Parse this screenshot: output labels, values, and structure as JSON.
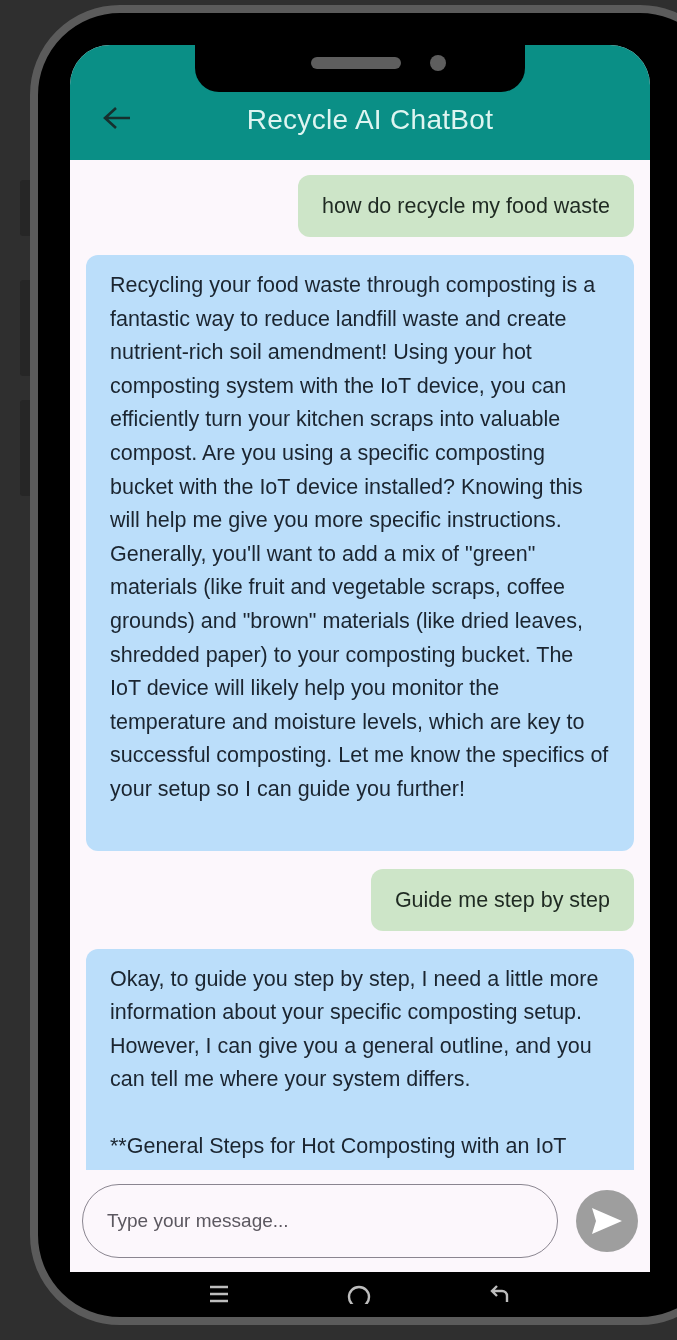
{
  "app_bar": {
    "title": "Recycle AI ChatBot"
  },
  "messages": [
    {
      "kind": "user",
      "text": "how do recycle my food waste"
    },
    {
      "kind": "bot",
      "text": "Recycling your food waste through composting is a fantastic way to reduce landfill waste and create nutrient-rich soil amendment!  Using your hot composting system with the IoT device, you can efficiently turn your kitchen scraps into valuable compost.  Are you using a specific composting bucket with the IoT device installed?  Knowing this will help me give you more specific instructions.  Generally, you'll want to add a mix of \"green\" materials (like fruit and vegetable scraps, coffee grounds) and \"brown\" materials (like dried leaves, shredded paper) to your composting bucket. The IoT device will likely help you monitor the temperature and moisture levels, which are key to successful composting.  Let me know the specifics of your setup so I can guide you further!"
    },
    {
      "kind": "user",
      "text": "Guide me step by step"
    },
    {
      "kind": "bot",
      "text": "Okay, to guide you step by step, I need a little more information about your specific composting setup.  However, I can give you a general outline, and you can tell me where your system differs.\n\n**General Steps for Hot Composting with an IoT"
    }
  ],
  "composer": {
    "placeholder": "Type your message..."
  }
}
